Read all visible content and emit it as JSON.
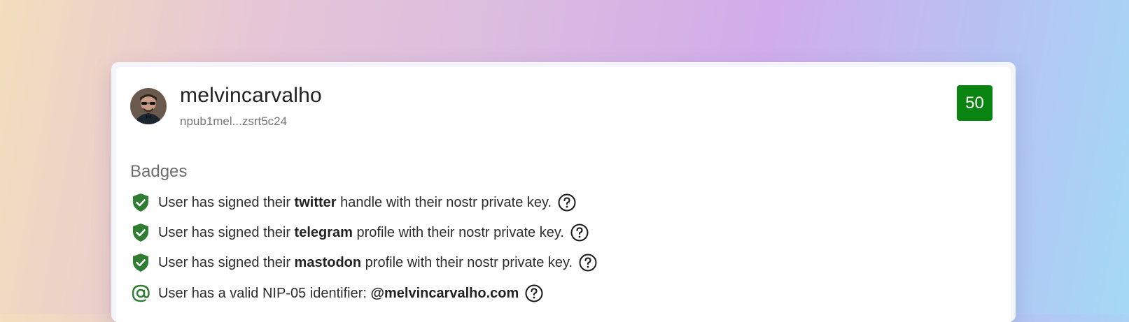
{
  "profile": {
    "username": "melvincarvalho",
    "npub": "npub1mel...zsrt5c24",
    "score": "50"
  },
  "badges": {
    "heading": "Badges",
    "items": [
      {
        "icon": "shield-check-icon",
        "prefix": "User has signed their ",
        "bold": "twitter",
        "suffix": " handle with their nostr private key."
      },
      {
        "icon": "shield-check-icon",
        "prefix": "User has signed their ",
        "bold": "telegram",
        "suffix": " profile with their nostr private key."
      },
      {
        "icon": "shield-check-icon",
        "prefix": "User has signed their ",
        "bold": "mastodon",
        "suffix": " profile with their nostr private key."
      },
      {
        "icon": "at-sign-icon",
        "prefix": "User has a valid NIP-05 identifier: ",
        "bold": "@melvincarvalho.com",
        "suffix": ""
      }
    ]
  },
  "colors": {
    "score_bg": "#0a8410",
    "badge_icon": "#2e7d32"
  }
}
